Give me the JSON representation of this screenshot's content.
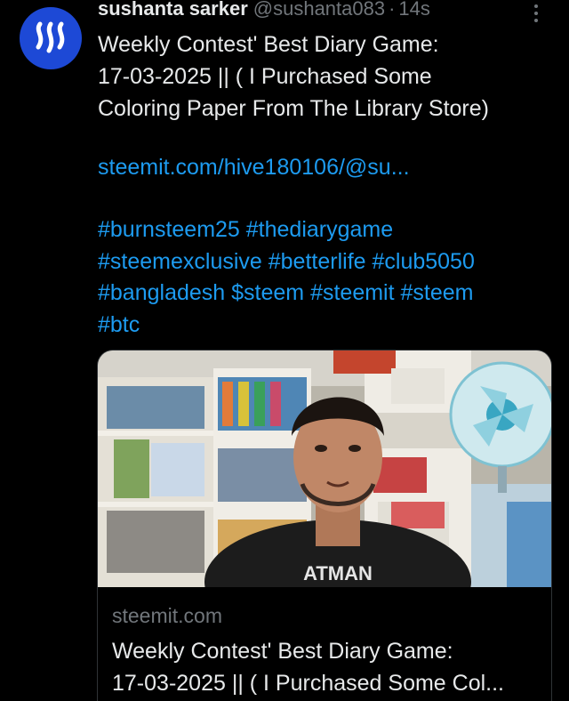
{
  "tweet": {
    "author_name": "sushanta sarker",
    "handle": "@sushanta083",
    "separator": "·",
    "time": "14s",
    "text_lines": [
      "Weekly Contest' Best Diary Game:",
      "17-03-2025 || ( I Purchased Some",
      "Coloring Paper From The Library Store)"
    ],
    "link": "steemit.com/hive180106/@su...",
    "hashtag_lines": [
      "#burnsteem25 #thediarygame",
      "#steemexclusive #betterlife #club5050",
      "#bangladesh $steem #steemit #steem",
      "#btc"
    ]
  },
  "card": {
    "domain": "steemit.com",
    "title_lines": [
      "Weekly Contest' Best Diary Game:",
      "17-03-2025 || ( I Purchased Some Col..."
    ],
    "shirt_text": "ATMAN"
  },
  "colors": {
    "background": "#000000",
    "text": "#e7e9ea",
    "muted": "#71767b",
    "link": "#1d9bf0",
    "avatar": "#1d49d6"
  },
  "icons": {
    "avatar": "steem-logo-icon",
    "more": "more-dots-icon"
  }
}
